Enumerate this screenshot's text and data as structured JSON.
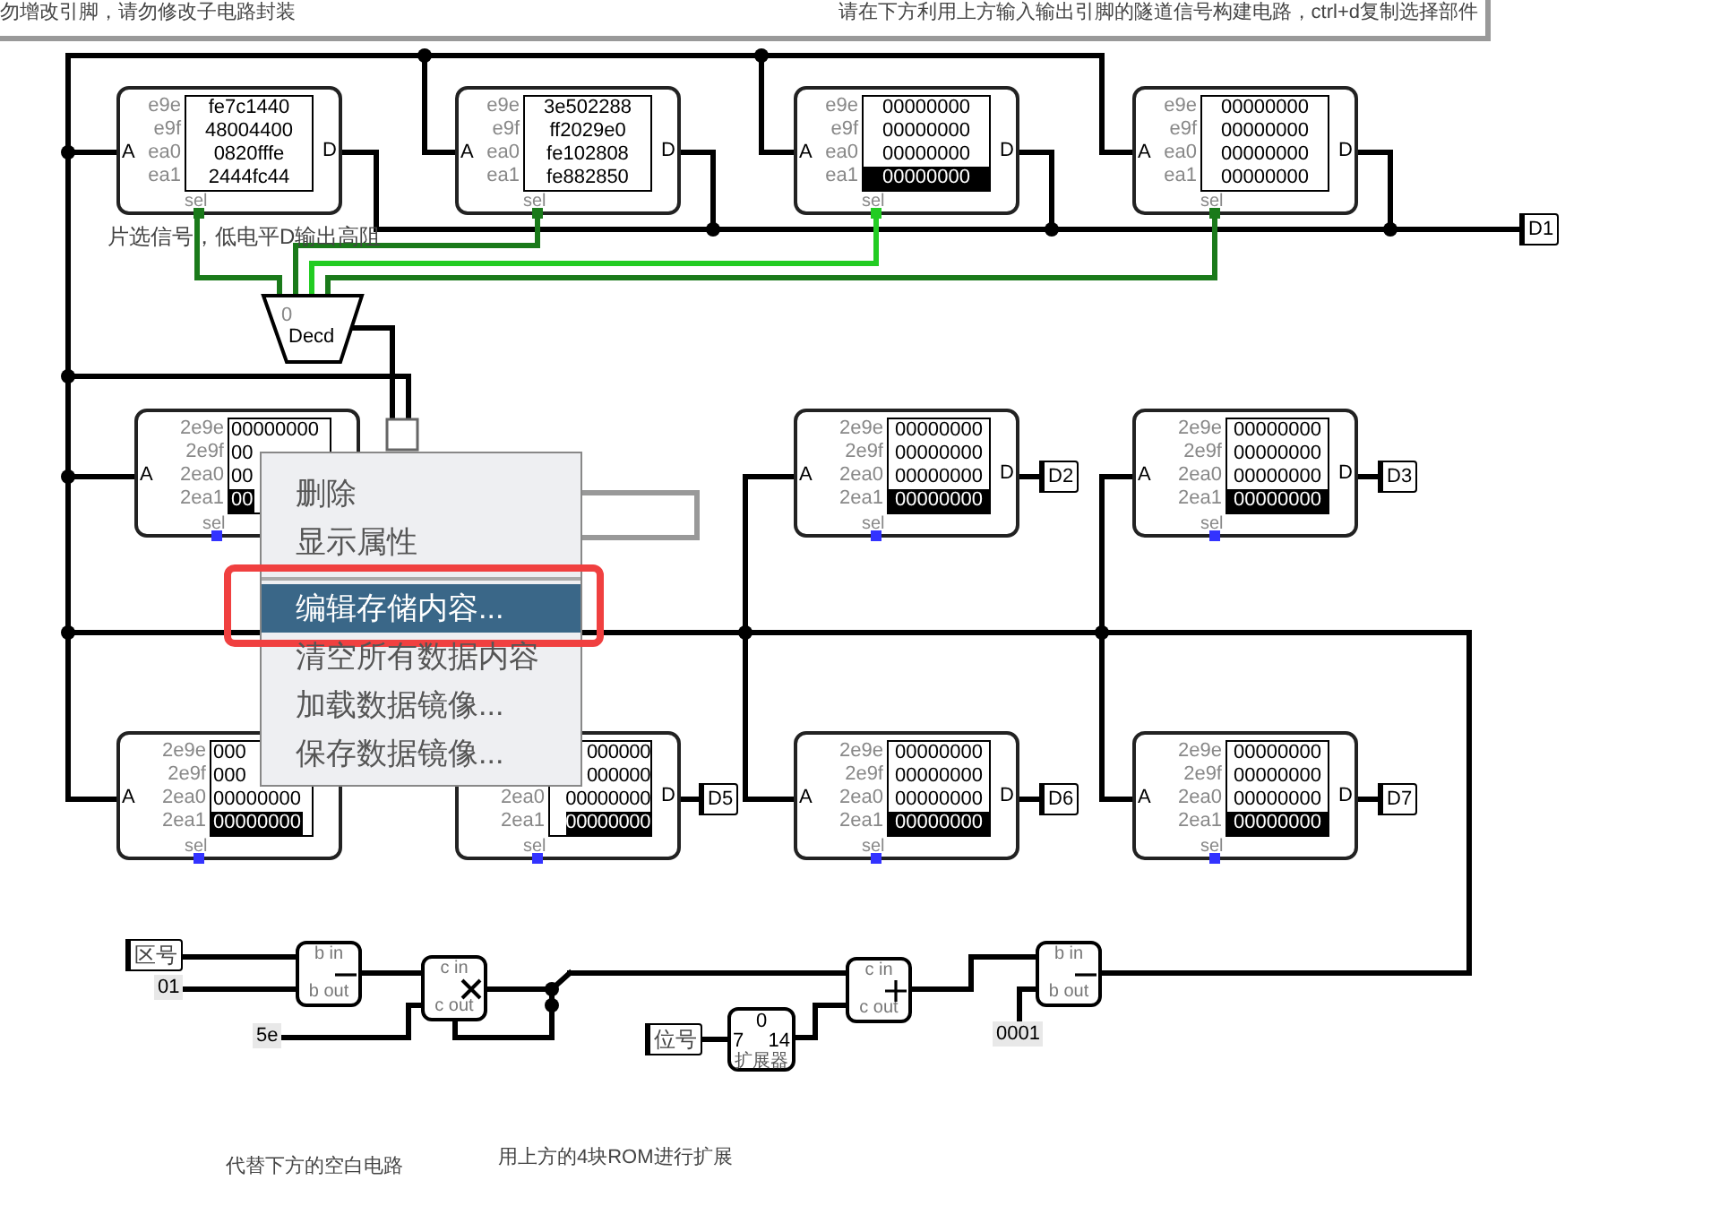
{
  "header": {
    "left_note": "勿增改引脚，请勿修改子电路封装",
    "right_note": "请在下方利用上方输入输出引脚的隧道信号构建电路，ctrl+d复制选择部件"
  },
  "roms": [
    {
      "a_label": "A",
      "d_label": "D",
      "sel_label": "sel",
      "color": "#1a7a1a",
      "rows": [
        {
          "address": "e9e",
          "value": "fe7c1440",
          "highlighted": false
        },
        {
          "address": "e9f",
          "value": "48004400",
          "highlighted": false
        },
        {
          "address": "ea0",
          "value": "0820fffe",
          "highlighted": false
        },
        {
          "address": "ea1",
          "value": "2444fc44",
          "highlighted": false
        }
      ]
    },
    {
      "a_label": "A",
      "d_label": "D",
      "sel_label": "sel",
      "color": "#1a7a1a",
      "rows": [
        {
          "address": "e9e",
          "value": "3e502288",
          "highlighted": false
        },
        {
          "address": "e9f",
          "value": "ff2029e0",
          "highlighted": false
        },
        {
          "address": "ea0",
          "value": "fe102808",
          "highlighted": false
        },
        {
          "address": "ea1",
          "value": "fe882850",
          "highlighted": false
        }
      ]
    },
    {
      "a_label": "A",
      "d_label": "D",
      "sel_label": "sel",
      "color": "#22cc22",
      "rows": [
        {
          "address": "e9e",
          "value": "00000000",
          "highlighted": false
        },
        {
          "address": "e9f",
          "value": "00000000",
          "highlighted": false
        },
        {
          "address": "ea0",
          "value": "00000000",
          "highlighted": false
        },
        {
          "address": "ea1",
          "value": "00000000",
          "highlighted": true
        }
      ]
    },
    {
      "a_label": "A",
      "d_label": "D",
      "sel_label": "sel",
      "color": "#1a7a1a",
      "rows": [
        {
          "address": "e9e",
          "value": "00000000",
          "highlighted": false
        },
        {
          "address": "e9f",
          "value": "00000000",
          "highlighted": false
        },
        {
          "address": "ea0",
          "value": "00000000",
          "highlighted": false
        },
        {
          "address": "ea1",
          "value": "00000000",
          "highlighted": false
        }
      ]
    },
    {
      "a_label": "A",
      "sel_label": "sel",
      "color": "#3333ff",
      "rows": [
        {
          "address": "2e9e",
          "value": "00000000",
          "highlighted": false
        },
        {
          "address": "2e9f",
          "value": "00",
          "highlighted": false
        },
        {
          "address": "2ea0",
          "value": "00",
          "highlighted": false
        },
        {
          "address": "2ea1",
          "value": "00",
          "highlighted": true
        }
      ]
    },
    {
      "a_label": "A",
      "d_label": "D",
      "sel_label": "sel",
      "color": "#3333ff",
      "rows": [
        {
          "address": "2e9e",
          "value": "00000000",
          "highlighted": false
        },
        {
          "address": "2e9f",
          "value": "00000000",
          "highlighted": false
        },
        {
          "address": "2ea0",
          "value": "00000000",
          "highlighted": false
        },
        {
          "address": "2ea1",
          "value": "00000000",
          "highlighted": true
        }
      ]
    },
    {
      "a_label": "A",
      "d_label": "D",
      "sel_label": "sel",
      "color": "#3333ff",
      "rows": [
        {
          "address": "2e9e",
          "value": "00000000",
          "highlighted": false
        },
        {
          "address": "2e9f",
          "value": "00000000",
          "highlighted": false
        },
        {
          "address": "2ea0",
          "value": "00000000",
          "highlighted": false
        },
        {
          "address": "2ea1",
          "value": "00000000",
          "highlighted": true
        }
      ]
    },
    {
      "a_label": "A",
      "sel_label": "sel",
      "color": "#3333ff",
      "rows": [
        {
          "address": "2e9e",
          "value": "000",
          "highlighted": false
        },
        {
          "address": "2e9f",
          "value": "000",
          "highlighted": false
        },
        {
          "address": "2ea0",
          "value": "00000000",
          "highlighted": false
        },
        {
          "address": "2ea1",
          "value": "00000000",
          "highlighted": true
        }
      ]
    },
    {
      "d_label": "D",
      "sel_label": "sel",
      "color": "#3333ff",
      "rows": [
        {
          "value": "000000",
          "highlighted": false
        },
        {
          "value": "000000",
          "highlighted": false
        },
        {
          "address": "2ea0",
          "value": "00000000",
          "highlighted": false
        },
        {
          "address": "2ea1",
          "value": "00000000",
          "highlighted": true
        }
      ]
    },
    {
      "a_label": "A",
      "d_label": "D",
      "sel_label": "sel",
      "color": "#3333ff",
      "rows": [
        {
          "address": "2e9e",
          "value": "00000000",
          "highlighted": false
        },
        {
          "address": "2e9f",
          "value": "00000000",
          "highlighted": false
        },
        {
          "address": "2ea0",
          "value": "00000000",
          "highlighted": false
        },
        {
          "address": "2ea1",
          "value": "00000000",
          "highlighted": true
        }
      ]
    },
    {
      "a_label": "A",
      "d_label": "D",
      "sel_label": "sel",
      "color": "#3333ff",
      "rows": [
        {
          "address": "2e9e",
          "value": "00000000",
          "highlighted": false
        },
        {
          "address": "2e9f",
          "value": "00000000",
          "highlighted": false
        },
        {
          "address": "2ea0",
          "value": "00000000",
          "highlighted": false
        },
        {
          "address": "2ea1",
          "value": "00000000",
          "highlighted": true
        }
      ]
    }
  ],
  "chip_select_note": "片选信号，低电平D输出高阻",
  "decoder": {
    "index": "0",
    "label": "Decd"
  },
  "tunnels": [
    {
      "label": "D1"
    },
    {
      "label": "D2"
    },
    {
      "label": "D3"
    },
    {
      "label": "D5"
    },
    {
      "label": "D6"
    },
    {
      "label": "D7"
    }
  ],
  "parts": [
    {
      "kind": "tunnel",
      "label": "区号"
    },
    {
      "kind": "constant",
      "label": "01"
    },
    {
      "kind": "subtractor",
      "top_label": "b in",
      "bottom_label": "b out"
    },
    {
      "kind": "constant",
      "label": "5e"
    },
    {
      "kind": "multiplier",
      "top_label": "c in",
      "bottom_label": "c out"
    },
    {
      "kind": "tunnel",
      "label": "位号"
    },
    {
      "kind": "extender",
      "top_label": "0",
      "in_label": "7",
      "out_label": "14",
      "label": "扩展器"
    },
    {
      "kind": "adder",
      "top_label": "c in",
      "bottom_label": "c out"
    },
    {
      "kind": "subtractor",
      "top_label": "b in",
      "bottom_label": "b out"
    },
    {
      "kind": "constant",
      "label": "0001"
    }
  ],
  "notes": [
    "代替下方的空白电路",
    "用上方的4块ROM进行扩展"
  ],
  "context_menu": {
    "items": [
      {
        "kind": "item",
        "label": "删除",
        "selected": false,
        "outlined": false
      },
      {
        "kind": "item",
        "label": "显示属性",
        "selected": false,
        "outlined": false
      },
      {
        "kind": "separator"
      },
      {
        "kind": "item",
        "label": "编辑存储内容...",
        "selected": true,
        "outlined": true
      },
      {
        "kind": "item",
        "label": "清空所有数据内容",
        "selected": false,
        "outlined": false
      },
      {
        "kind": "item",
        "label": "加载数据镜像...",
        "selected": false,
        "outlined": false
      },
      {
        "kind": "item",
        "label": "保存数据镜像...",
        "selected": false,
        "outlined": false
      }
    ]
  }
}
